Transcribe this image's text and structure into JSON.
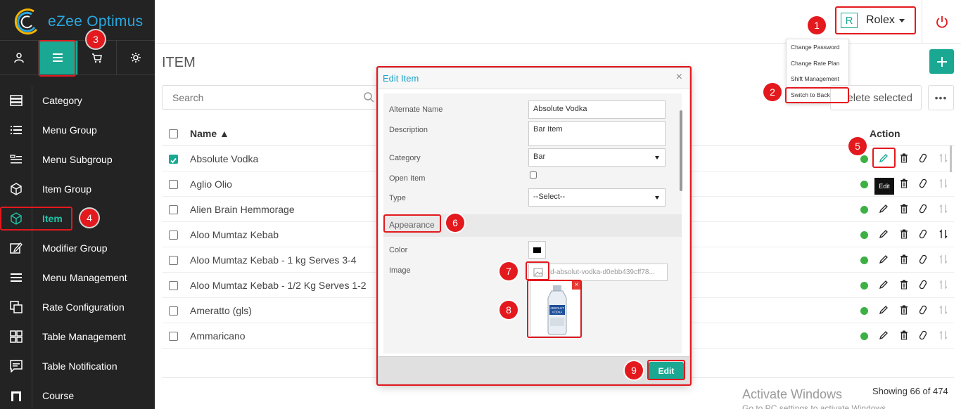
{
  "app": {
    "logo_text": "eZee Optimus"
  },
  "sidebar": {
    "icon_tabs": [
      {
        "icon": "user-icon"
      },
      {
        "icon": "menu-icon"
      },
      {
        "icon": "cart-icon"
      },
      {
        "icon": "gear-icon"
      }
    ],
    "items": [
      {
        "label": "Category",
        "icon": "category-icon"
      },
      {
        "label": "Menu Group",
        "icon": "list-icon"
      },
      {
        "label": "Menu Subgroup",
        "icon": "sublist-icon"
      },
      {
        "label": "Item Group",
        "icon": "cube-icon"
      },
      {
        "label": "Item",
        "icon": "cube-icon"
      },
      {
        "label": "Modifier Group",
        "icon": "edit-box-icon"
      },
      {
        "label": "Menu Management",
        "icon": "hamburger-icon"
      },
      {
        "label": "Rate Configuration",
        "icon": "copy-icon"
      },
      {
        "label": "Table Management",
        "icon": "grid-icon"
      },
      {
        "label": "Table Notification",
        "icon": "message-icon"
      },
      {
        "label": "Course",
        "icon": "course-icon"
      }
    ]
  },
  "header": {
    "user_initial": "R",
    "user_name": "Rolex",
    "user_menu": [
      "Change Password",
      "Change Rate Plan",
      "Shift Management",
      "Switch to Back"
    ]
  },
  "main": {
    "title": "ITEM",
    "search_placeholder": "Search",
    "delete_label": "elete selected",
    "more_label": "•••",
    "columns": {
      "name": "Name ▲",
      "action": "Action"
    },
    "rows": [
      {
        "name": "Absolute Vodka",
        "checked": true
      },
      {
        "name": "Aglio Olio",
        "checked": false
      },
      {
        "name": "Alien Brain Hemmorage",
        "checked": false
      },
      {
        "name": "Aloo Mumtaz Kebab",
        "checked": false
      },
      {
        "name": "Aloo Mumtaz Kebab - 1 kg Serves 3-4",
        "checked": false
      },
      {
        "name": "Aloo Mumtaz Kebab - 1/2 Kg Serves 1-2",
        "checked": false
      },
      {
        "name": "Ameratto (gls)",
        "checked": false
      },
      {
        "name": "Ammaricano",
        "checked": false
      }
    ],
    "tooltip": "Edit",
    "footer_showing": "Showing 66 of 474"
  },
  "watermark": {
    "title": "Activate Windows",
    "subtitle": "Go to PC settings to activate Windows."
  },
  "modal": {
    "title": "Edit Item",
    "close": "×",
    "fields": {
      "alternate_name_label": "Alternate Name",
      "alternate_name_value": "Absolute Vodka",
      "description_label": "Description",
      "description_value": "Bar Item",
      "category_label": "Category",
      "category_value": "Bar",
      "open_item_label": "Open Item",
      "type_label": "Type",
      "type_value": "--Select--",
      "appearance_label": "Appearance",
      "color_label": "Color",
      "color_value": "#000000",
      "image_label": "Image",
      "image_value": "d-absolut-vodka-d0ebb439cff78..."
    },
    "preview_label": "ABSOLUT VODKA",
    "remove_label": "×",
    "edit_button": "Edit"
  },
  "annotations": [
    "1",
    "2",
    "3",
    "4",
    "5",
    "6",
    "7",
    "8",
    "9"
  ],
  "colors": {
    "accent": "#1aa893",
    "highlight": "#e3191e",
    "sidebar": "#232323",
    "link": "#1aa0c8"
  }
}
